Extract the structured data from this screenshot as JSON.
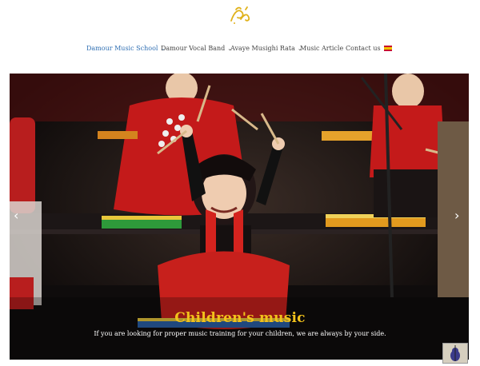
{
  "brand": {
    "logo_icon": "calligraphy-logo-icon",
    "color": "#e0b21b"
  },
  "nav": {
    "items": [
      {
        "label": "Damour Music School",
        "has_dropdown": true,
        "active": true
      },
      {
        "label": "Damour Vocal Band",
        "has_dropdown": true,
        "active": false
      },
      {
        "label": "Avaye Musighi Rata",
        "has_dropdown": true,
        "active": false
      },
      {
        "label": "Music Article",
        "has_dropdown": false,
        "active": false
      },
      {
        "label": "Contact us",
        "has_dropdown": false,
        "active": false
      }
    ],
    "chevron": "⌄",
    "language_flag": "spain-flag-icon",
    "active_color": "#2f6fb3"
  },
  "slider": {
    "image": "children-music-performance-photo",
    "title": "Children's music",
    "subtitle": "If you are looking for proper music training for your children, we are always by your side.",
    "prev_icon": "‹",
    "next_icon": "›",
    "title_color": "#f2c21b"
  },
  "floating": {
    "thumbnail": "violin-thumbnail-icon"
  }
}
